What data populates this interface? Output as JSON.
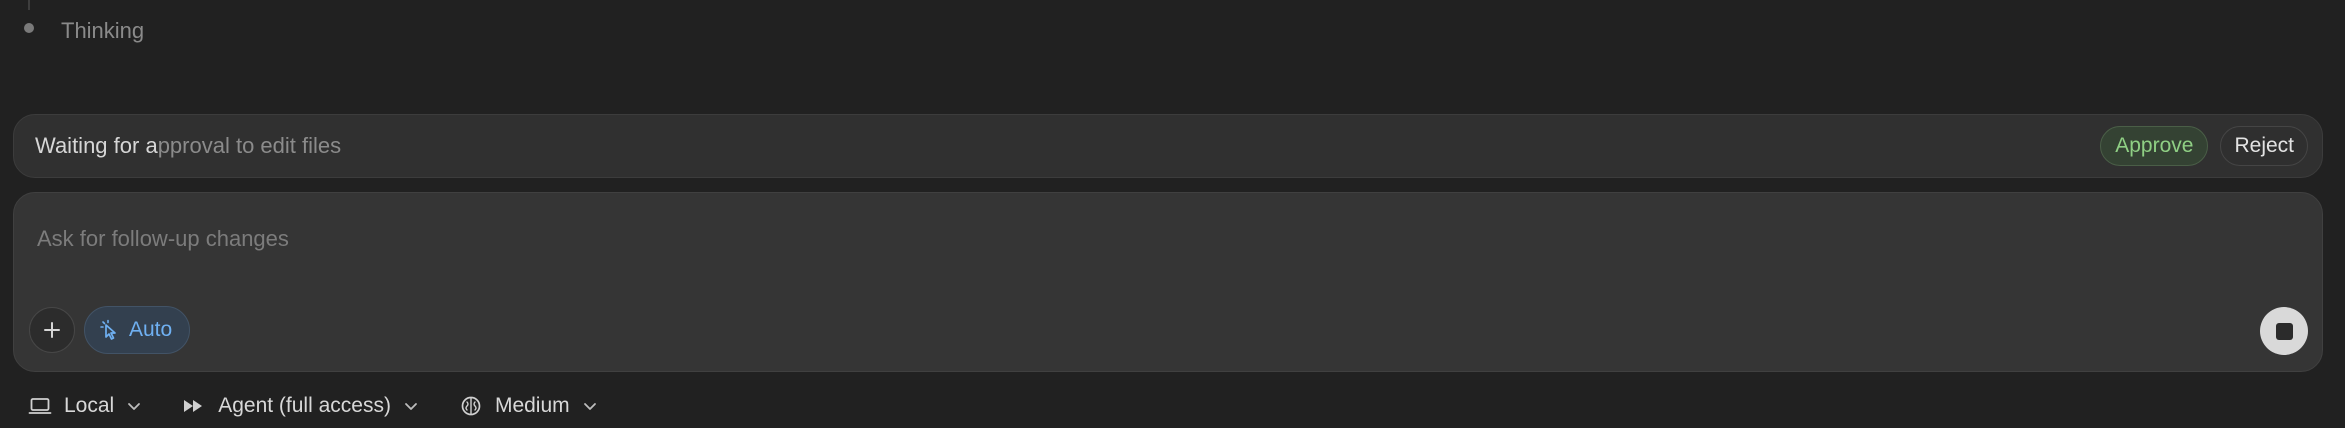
{
  "thinking": {
    "label": "Thinking"
  },
  "approval": {
    "text_strong": "Waiting for a",
    "text_dim": "pproval to edit files",
    "approve_label": "Approve",
    "reject_label": "Reject"
  },
  "composer": {
    "placeholder": "Ask for follow-up changes",
    "mode_label": "Auto",
    "add_icon": "plus-icon",
    "mode_icon": "cursor-click-icon",
    "stop_icon": "stop-icon"
  },
  "footer": {
    "items": [
      {
        "label": "Local",
        "icon": "laptop-icon"
      },
      {
        "label": "Agent (full access)",
        "icon": "fast-forward-icon"
      },
      {
        "label": "Medium",
        "icon": "brain-icon"
      }
    ]
  },
  "colors": {
    "background": "#212121",
    "approve_accent": "#8fcf84",
    "auto_accent": "#6fb0f2"
  }
}
